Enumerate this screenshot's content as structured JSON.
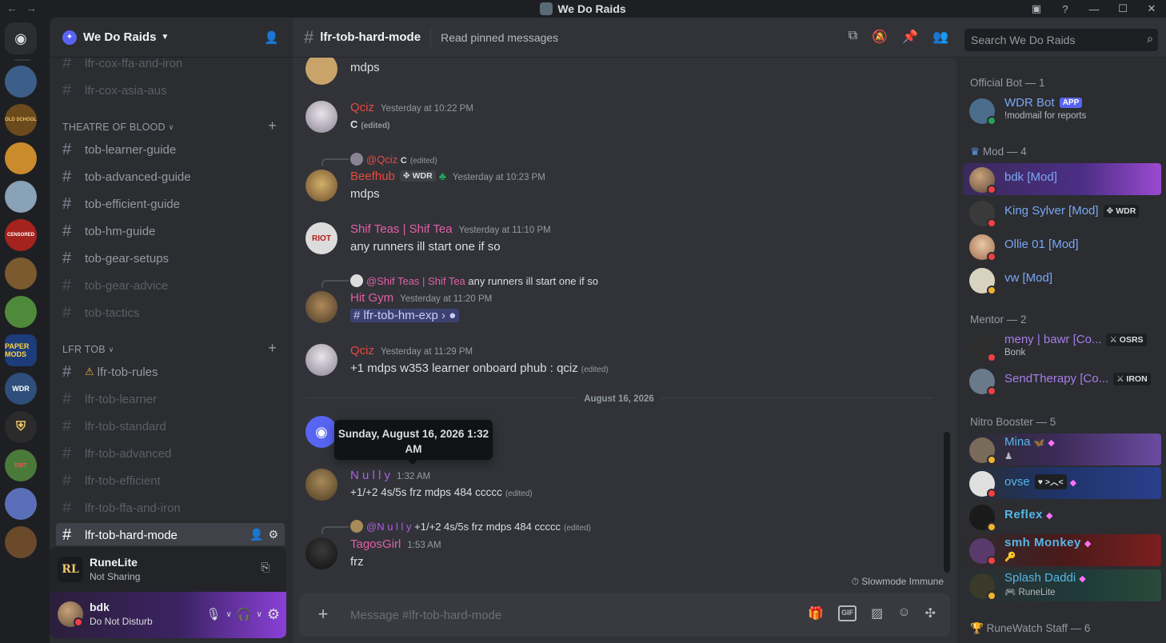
{
  "window": {
    "title": "We Do Raids"
  },
  "guild": {
    "name": "We Do Raids"
  },
  "sidebar": {
    "channels_top": [
      {
        "label": "lfr-cox-ffa-and-iron",
        "muted": true
      },
      {
        "label": "lfr-cox-asia-aus",
        "muted": true
      }
    ],
    "cat_tob": "THEATRE OF BLOOD",
    "channels_tob": [
      {
        "label": "tob-learner-guide"
      },
      {
        "label": "tob-advanced-guide"
      },
      {
        "label": "tob-efficient-guide"
      },
      {
        "label": "tob-hm-guide"
      },
      {
        "label": "tob-gear-setups"
      },
      {
        "label": "tob-gear-advice"
      },
      {
        "label": "tob-tactics"
      }
    ],
    "cat_lfr": "LFR TOB",
    "channels_lfr": [
      {
        "label": "lfr-tob-rules"
      },
      {
        "label": "lfr-tob-learner"
      },
      {
        "label": "lfr-tob-standard"
      },
      {
        "label": "lfr-tob-advanced"
      },
      {
        "label": "lfr-tob-efficient"
      },
      {
        "label": "lfr-tob-ffa-and-iron"
      },
      {
        "label": "lfr-tob-hard-mode"
      }
    ]
  },
  "activity": {
    "logo": "RL",
    "title": "RuneLite",
    "subtitle": "Not Sharing"
  },
  "user": {
    "name": "bdk",
    "status": "Do Not Disturb"
  },
  "header": {
    "channel": "lfr-tob-hard-mode",
    "topic": "Read pinned messages"
  },
  "search": {
    "placeholder": "Search We Do Raids"
  },
  "messages": {
    "m0": {
      "text": "mdps"
    },
    "m1": {
      "author": "Qciz",
      "time": "Yesterday at 10:22 PM",
      "text": "C",
      "edited": "(edited)"
    },
    "m2": {
      "reply_author": "@Qciz",
      "reply_text": "C",
      "reply_edited": "(edited)",
      "author": "Beefhub",
      "tag": "WDR",
      "time": "Yesterday at 10:23 PM",
      "text": "mdps"
    },
    "m3": {
      "author": "Shif Teas | Shif Tea",
      "time": "Yesterday at 11:10 PM",
      "text": "any runners ill start one if so",
      "avatar_text": "RIOT"
    },
    "m4": {
      "reply_author": "@Shif Teas | Shif Tea",
      "reply_text": "any runners ill start one if so",
      "author": "Hit Gym",
      "time": "Yesterday at 11:20 PM",
      "mention": "lfr-tob-hm-exp"
    },
    "m5": {
      "author": "Qciz",
      "time": "Yesterday at 11:29 PM",
      "text": "+1 mdps w353 learner onboard phub : qciz",
      "edited": "(edited)"
    },
    "date_divider": "August 16, 2026",
    "tooltip": "Sunday, August 16, 2026 1:32 AM",
    "m6": {
      "author": "N u l l y",
      "time": "1:32 AM",
      "text": "+1/+2 4s/5s frz mdps 484 ccccc",
      "edited": "(edited)"
    },
    "m7": {
      "reply_author": "@N u l l y",
      "reply_text": "+1/+2 4s/5s frz mdps 484 ccccc",
      "reply_edited": "(edited)",
      "author": "TagosGirl",
      "time": "1:53 AM",
      "text": "frz"
    },
    "slowmode": "Slowmode Immune"
  },
  "composer": {
    "placeholder": "Message #lfr-tob-hard-mode"
  },
  "members": {
    "cat_bot": "Official Bot — 1",
    "bot": {
      "name": "WDR Bot",
      "badge": "APP",
      "sub": "!modmail for reports"
    },
    "cat_mod": "Mod — 4",
    "mods": [
      {
        "name": "bdk [Mod]"
      },
      {
        "name": "King Sylver [Mod]",
        "tag": "WDR"
      },
      {
        "name": "Ollie 01 [Mod]"
      },
      {
        "name": "vw [Mod]"
      }
    ],
    "cat_mentor": "Mentor — 2",
    "mentors": [
      {
        "name": "meny | bawr [Co...",
        "tag": "OSRS",
        "sub": "Bonk"
      },
      {
        "name": "SendTherapy [Co...",
        "tag": "IRON"
      }
    ],
    "cat_nitro": "Nitro Booster — 5",
    "nitro": [
      {
        "name": "Mina"
      },
      {
        "name": "ovse",
        "tag": ">︿<"
      },
      {
        "name": "Reflex"
      },
      {
        "name": "smh Monkey"
      },
      {
        "name": "Splash Daddi",
        "sub": "RuneLite"
      }
    ],
    "cat_staff": "RuneWatch Staff — 6"
  },
  "colors": {
    "accent": "#5865f2",
    "mod_name": "#7aa7f5",
    "nitro_name": "#56b6e6",
    "red_name": "#e8493f",
    "pink_name": "#e35fa8",
    "purple_name": "#b45ce8"
  }
}
